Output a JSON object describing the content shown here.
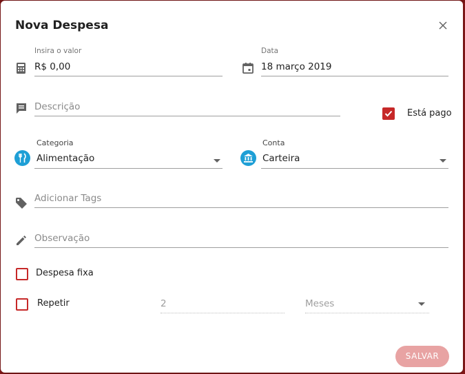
{
  "dialog": {
    "title": "Nova Despesa",
    "close_icon": "close-icon"
  },
  "valor": {
    "label": "Insira o valor",
    "value": "R$ 0,00",
    "icon": "calculator-icon"
  },
  "data": {
    "label": "Data",
    "value": "18 março 2019",
    "icon": "calendar-icon"
  },
  "descricao": {
    "placeholder": "Descrição",
    "icon": "description-icon"
  },
  "esta_pago": {
    "label": "Está pago",
    "checked": true
  },
  "categoria": {
    "label": "Categoria",
    "value": "Alimentação",
    "icon": "food-category-icon",
    "icon_color": "#1e9fd6"
  },
  "conta": {
    "label": "Conta",
    "value": "Carteira",
    "icon": "bank-icon",
    "icon_color": "#1e9fd6"
  },
  "tags": {
    "placeholder": "Adicionar Tags",
    "icon": "tag-icon"
  },
  "observacao": {
    "placeholder": "Observação",
    "icon": "pencil-icon"
  },
  "despesa_fixa": {
    "label": "Despesa fixa",
    "checked": false
  },
  "repetir": {
    "label": "Repetir",
    "checked": false,
    "count": "2",
    "period": "Meses"
  },
  "actions": {
    "save_label": "SALVAR"
  },
  "colors": {
    "accent": "#c62828",
    "save_disabled": "#e8a3a3",
    "icon_blue": "#1e9fd6"
  }
}
